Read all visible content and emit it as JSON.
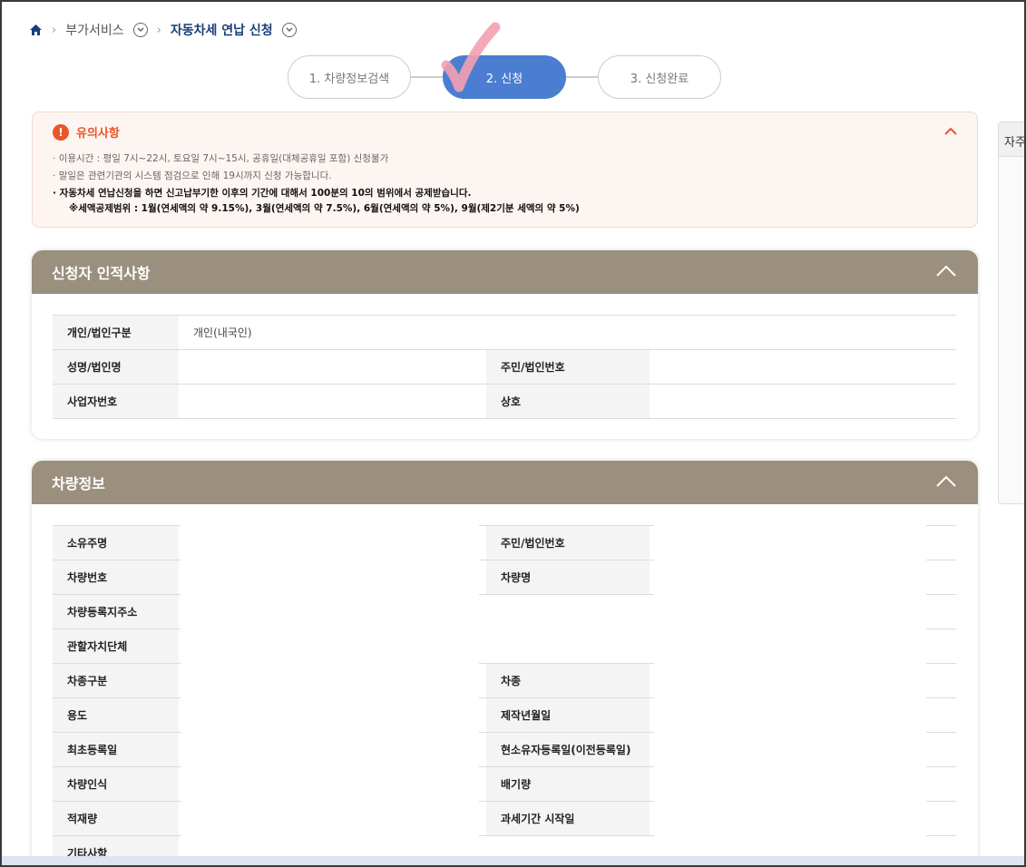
{
  "breadcrumb": {
    "home_icon": "home-icon",
    "item1": "부가서비스",
    "current": "자동차세 연납 신청"
  },
  "steps": [
    {
      "label": "1. 차량정보검색",
      "state": "done"
    },
    {
      "label": "2. 신청",
      "state": "active"
    },
    {
      "label": "3. 신청완료",
      "state": "todo"
    }
  ],
  "notice": {
    "title": "유의사항",
    "lines": [
      "이용시간 : 평일 7시~22시, 토요일 7시~15시, 공휴일(대체공휴일 포함) 신청불가",
      "말일은 관련기관의 시스템 점검으로 인해 19시까지 신청 가능합니다.",
      "자동차세 연납신청을 하면 신고납부기한 이후의 기간에 대해서 100분의 10의 범위에서 공제받습니다."
    ],
    "subline": "※세액공제범위 : 1월(연세액의 약 9.15%), 3월(연세액의 약 7.5%), 6월(연세액의 약 5%), 9월(제2기분 세액의 약 5%)"
  },
  "applicant": {
    "title": "신청자 인적사항",
    "type_label": "개인/법인구분",
    "type_value": "개인(내국인)",
    "name_label": "성명/법인명",
    "name_value": "",
    "id_label": "주민/법인번호",
    "id_value": "",
    "bizno_label": "사업자번호",
    "bizno_value": "",
    "company_label": "상호",
    "company_value": ""
  },
  "vehicle": {
    "title": "차량정보",
    "rows": [
      {
        "l1": "소유주명",
        "v1": "",
        "l2": "주민/법인번호",
        "v2": ""
      },
      {
        "l1": "차량번호",
        "v1": "",
        "l2": "차량명",
        "v2": ""
      },
      {
        "l1": "차량등록지주소",
        "v1": "",
        "l2": "",
        "v2": ""
      },
      {
        "l1": "관할자치단체",
        "v1": "",
        "l2": "",
        "v2": ""
      },
      {
        "l1": "차종구분",
        "v1": "",
        "l2": "차종",
        "v2": ""
      },
      {
        "l1": "용도",
        "v1": "",
        "l2": "제작년월일",
        "v2": ""
      },
      {
        "l1": "최초등록일",
        "v1": "",
        "l2": "현소유자등록일(이전등록일)",
        "v2": ""
      },
      {
        "l1": "차량인식",
        "v1": "",
        "l2": "배기량",
        "v2": ""
      },
      {
        "l1": "적재량",
        "v1": "",
        "l2": "과세기간 시작일",
        "v2": ""
      },
      {
        "l1": "기타사항",
        "v1": "",
        "l2": "",
        "v2": ""
      }
    ]
  },
  "sidebar": {
    "title": "자주"
  },
  "colors": {
    "accent": "#4b7ed1",
    "panel_header": "#9b8f7e",
    "warning": "#e8562a",
    "checkmark": "#f4a0b0"
  }
}
